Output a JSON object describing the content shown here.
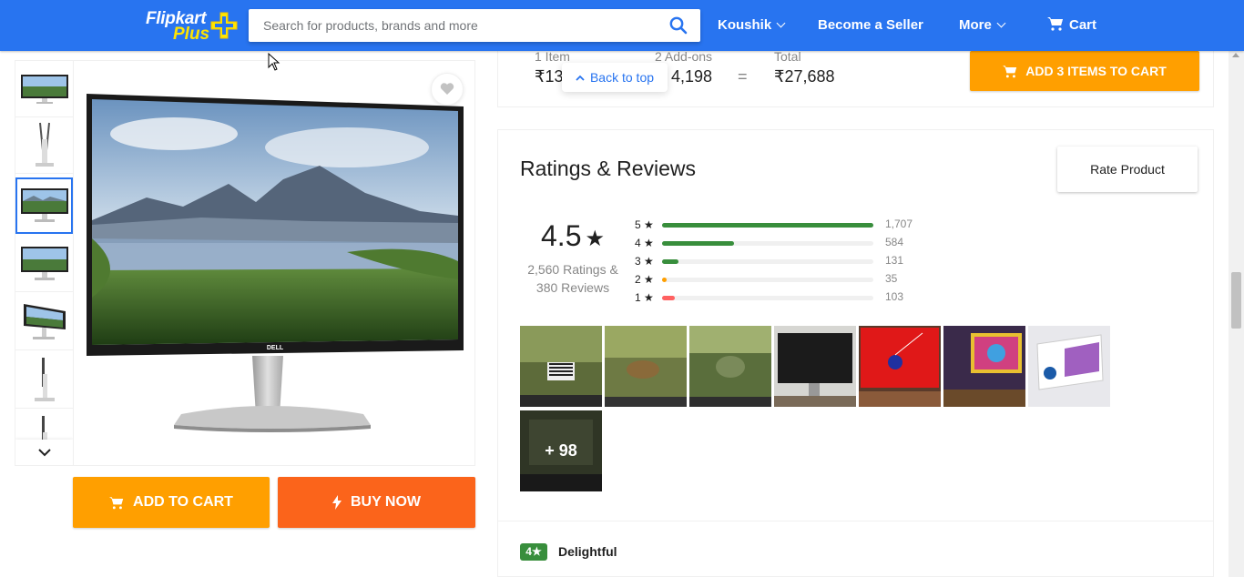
{
  "header": {
    "logo_word1": "Flipkart",
    "logo_word2": "Plus",
    "search_placeholder": "Search for products, brands and more",
    "user_name": "Koushik",
    "become_seller": "Become a Seller",
    "more": "More",
    "cart": "Cart",
    "brand_color": "#2874f0"
  },
  "product": {
    "thumbnail_count": 7,
    "selected_thumbnail": 3,
    "add_to_cart": "ADD TO CART",
    "buy_now": "BUY NOW",
    "brand_text": "DELL"
  },
  "combo": {
    "item_label": "1 Item",
    "item_price": "₹13",
    "addons_label": "2 Add-ons",
    "addons_price": "4,198",
    "equals": "=",
    "total_label": "Total",
    "total_price": "₹27,688",
    "back_to_top": "Back to top",
    "add_button": "ADD 3 ITEMS TO CART"
  },
  "ratings": {
    "title": "Ratings & Reviews",
    "rate_button": "Rate Product",
    "average": "4.5",
    "star": "★",
    "summary_line1": "2,560 Ratings &",
    "summary_line2": "380 Reviews",
    "breakdown": [
      {
        "stars": "5",
        "count": "1,707",
        "fraction": 1.0,
        "color": "#388e3c"
      },
      {
        "stars": "4",
        "count": "584",
        "fraction": 0.342,
        "color": "#388e3c"
      },
      {
        "stars": "3",
        "count": "131",
        "fraction": 0.077,
        "color": "#388e3c"
      },
      {
        "stars": "2",
        "count": "35",
        "fraction": 0.021,
        "color": "#ff9f00"
      },
      {
        "stars": "1",
        "count": "103",
        "fraction": 0.06,
        "color": "#ff6161"
      }
    ],
    "more_photos": "+ 98"
  },
  "review": {
    "rating": "4",
    "title": "Delightful"
  }
}
